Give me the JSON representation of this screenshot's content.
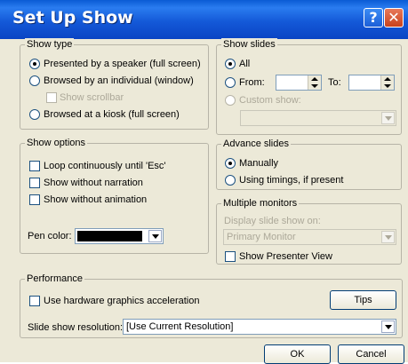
{
  "window": {
    "title": "Set Up Show",
    "help_button": "?",
    "close_button": "✕"
  },
  "show_type": {
    "label": "Show type",
    "options": [
      "Presented by a speaker (full screen)",
      "Browsed by an individual (window)",
      "Browsed at a kiosk (full screen)"
    ],
    "selected_index": 0,
    "scrollbar_label": "Show scrollbar"
  },
  "show_slides": {
    "label": "Show slides",
    "all_label": "All",
    "from_label": "From:",
    "to_label": "To:",
    "from_value": "",
    "to_value": "",
    "custom_label": "Custom show:",
    "custom_value": "",
    "selected": "All"
  },
  "show_options": {
    "label": "Show options",
    "loop_label": "Loop continuously until 'Esc'",
    "no_narration_label": "Show without narration",
    "no_animation_label": "Show without animation",
    "pen_color_label": "Pen color:",
    "pen_color": "#000000"
  },
  "advance_slides": {
    "label": "Advance slides",
    "manual_label": "Manually",
    "timings_label": "Using timings, if present",
    "selected": "Manually"
  },
  "monitors": {
    "label": "Multiple monitors",
    "display_label": "Display slide show on:",
    "display_value": "Primary Monitor",
    "presenter_label": "Show Presenter View"
  },
  "performance": {
    "label": "Performance",
    "hw_accel_label": "Use hardware graphics acceleration",
    "tips_label": "Tips",
    "resolution_label": "Slide show resolution:",
    "resolution_value": "[Use Current Resolution]"
  },
  "buttons": {
    "ok": "OK",
    "cancel": "Cancel"
  },
  "colors": {
    "title_bar": "#1459d8",
    "dialog_bg": "#ece9d8",
    "disabled_text": "#aca899"
  }
}
